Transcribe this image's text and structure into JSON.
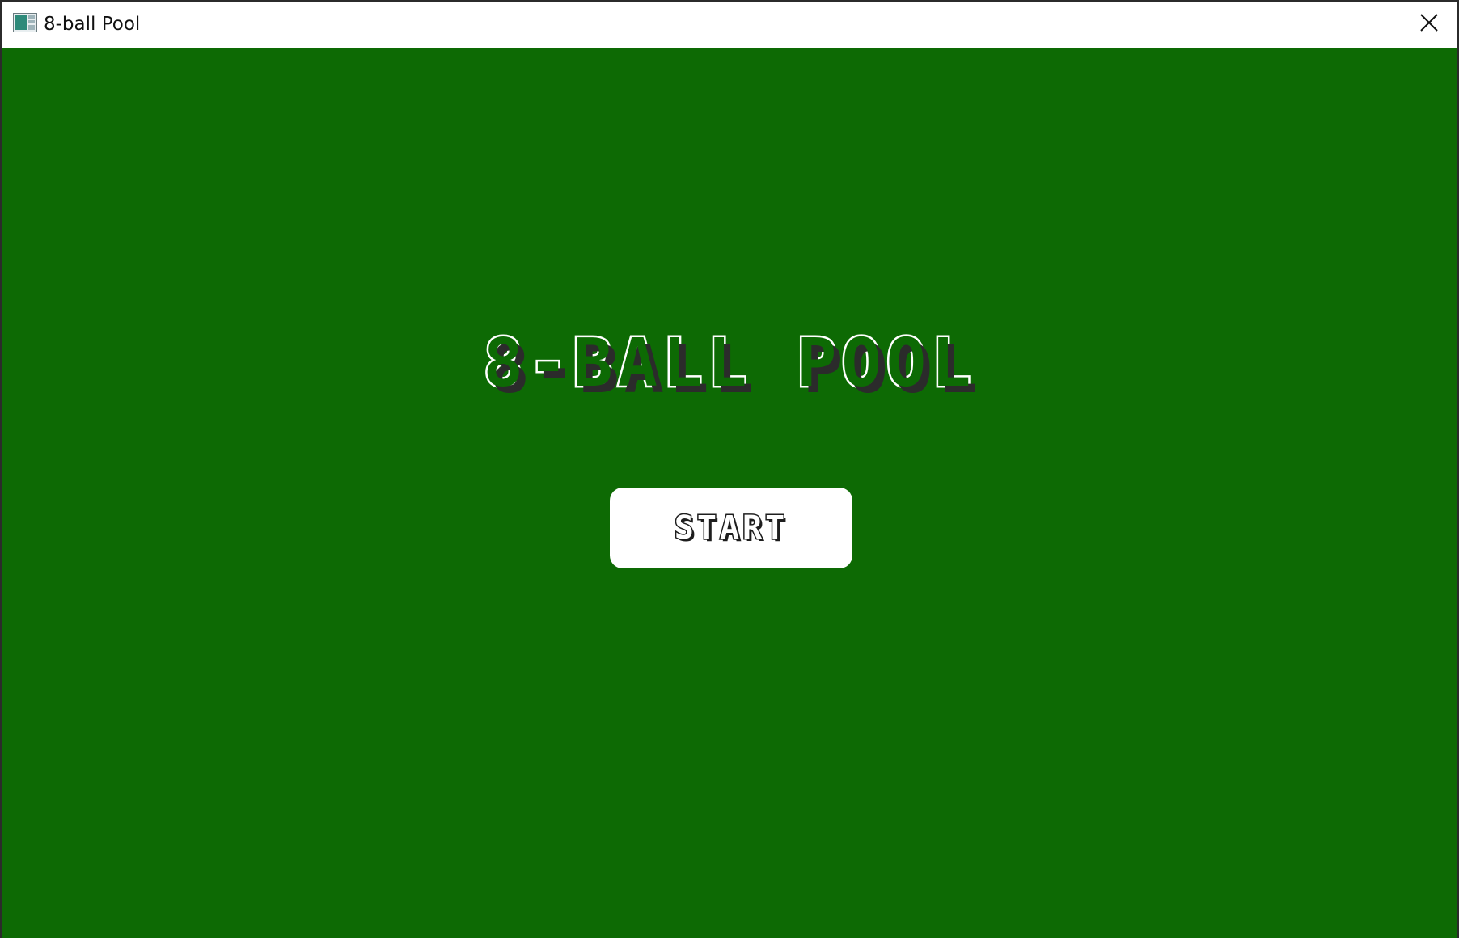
{
  "window": {
    "title": "8-ball Pool",
    "app_icon": "app-window-icon",
    "close_icon": "close-icon"
  },
  "game": {
    "title": "8-BALL POOL",
    "start_label": "START",
    "colors": {
      "felt": "#0d6a04",
      "text_outline": "#ffffff",
      "text_shadow": "#2b2b2b",
      "button_bg": "#ffffff"
    }
  }
}
